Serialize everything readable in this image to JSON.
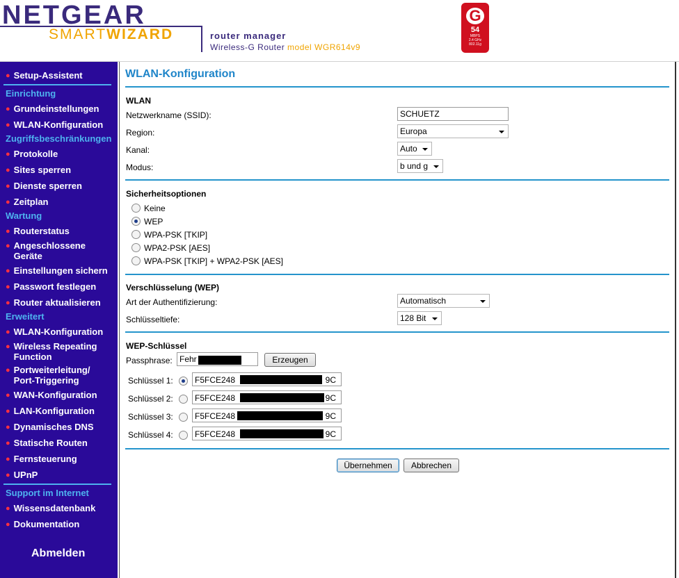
{
  "header": {
    "brand": "NETGEAR",
    "smart": "SMART",
    "wizard": "WIZARD",
    "router_manager": "router manager",
    "router_line": "Wireless-G Router",
    "model_line": "model WGR614v9",
    "badge": {
      "letter": "G",
      "speed": "54",
      "unit": "MBPS",
      "band": "2.4 GHz",
      "standard": "802.11g",
      "color": "#d0101f"
    }
  },
  "colors": {
    "sidebar_bg": "#2a0a99",
    "section_header": "#4eb2ef",
    "bullet": "#ff3040",
    "title": "#1f85c9",
    "rule": "#2494cc"
  },
  "sidebar": {
    "setup": "Setup-Assistent",
    "sec_einrichtung": "Einrichtung",
    "grund": "Grundeinstellungen",
    "wlan": "WLAN-Konfiguration",
    "sec_zugriff": "Zugriffsbeschränkungen",
    "protokolle": "Protokolle",
    "sites": "Sites sperren",
    "dienste": "Dienste sperren",
    "zeitplan": "Zeitplan",
    "sec_wartung": "Wartung",
    "routerstatus": "Routerstatus",
    "geraete_1": "Angeschlossene",
    "geraete_2": "Geräte",
    "sichern": "Einstellungen sichern",
    "passwort": "Passwort festlegen",
    "aktualisieren": "Router aktualisieren",
    "sec_erweitert": "Erweitert",
    "wlan2": "WLAN-Konfiguration",
    "repeating_1": "Wireless Repeating",
    "repeating_2": "Function",
    "port_1": "Portweiterleitung/",
    "port_2": "Port-Triggering",
    "wan": "WAN-Konfiguration",
    "lan": "LAN-Konfiguration",
    "dns": "Dynamisches DNS",
    "routen": "Statische Routen",
    "fern": "Fernsteuerung",
    "upnp": "UPnP",
    "sec_support": "Support im Internet",
    "wissen": "Wissensdatenbank",
    "doku": "Dokumentation",
    "logout": "Abmelden"
  },
  "main": {
    "title": "WLAN-Konfiguration",
    "wlan": {
      "section": "WLAN",
      "ssid_label": "Netzwerkname (SSID):",
      "ssid_value": "SCHUETZ",
      "region_label": "Region:",
      "region_value": "Europa",
      "kanal_label": "Kanal:",
      "kanal_value": "Auto",
      "modus_label": "Modus:",
      "modus_value": "b und g"
    },
    "security": {
      "section": "Sicherheitsoptionen",
      "options": [
        "Keine",
        "WEP",
        "WPA-PSK [TKIP]",
        "WPA2-PSK [AES]",
        "WPA-PSK [TKIP] + WPA2-PSK [AES]"
      ],
      "selected": "WEP"
    },
    "wep": {
      "section": "Verschlüsselung (WEP)",
      "auth_label": "Art der Authentifizierung:",
      "auth_value": "Automatisch",
      "depth_label": "Schlüsseltiefe:",
      "depth_value": "128 Bit"
    },
    "keys": {
      "section": "WEP-Schlüssel",
      "passphrase_label": "Passphrase:",
      "passphrase_value": "Fehr",
      "generate_button": "Erzeugen",
      "key1_label": "Schlüssel 1:",
      "key1_prefix": "F5FCE248",
      "key1_suffix": "9C",
      "key2_label": "Schlüssel 2:",
      "key2_prefix": "F5FCE248",
      "key2_suffix": "9C",
      "key3_label": "Schlüssel 3:",
      "key3_prefix": "F5FCE248",
      "key3_suffix": "9C",
      "key4_label": "Schlüssel 4:",
      "key4_prefix": "F5FCE248",
      "key4_suffix": "9C",
      "selected_key": 1
    },
    "apply_button": "Übernehmen",
    "cancel_button": "Abbrechen"
  }
}
